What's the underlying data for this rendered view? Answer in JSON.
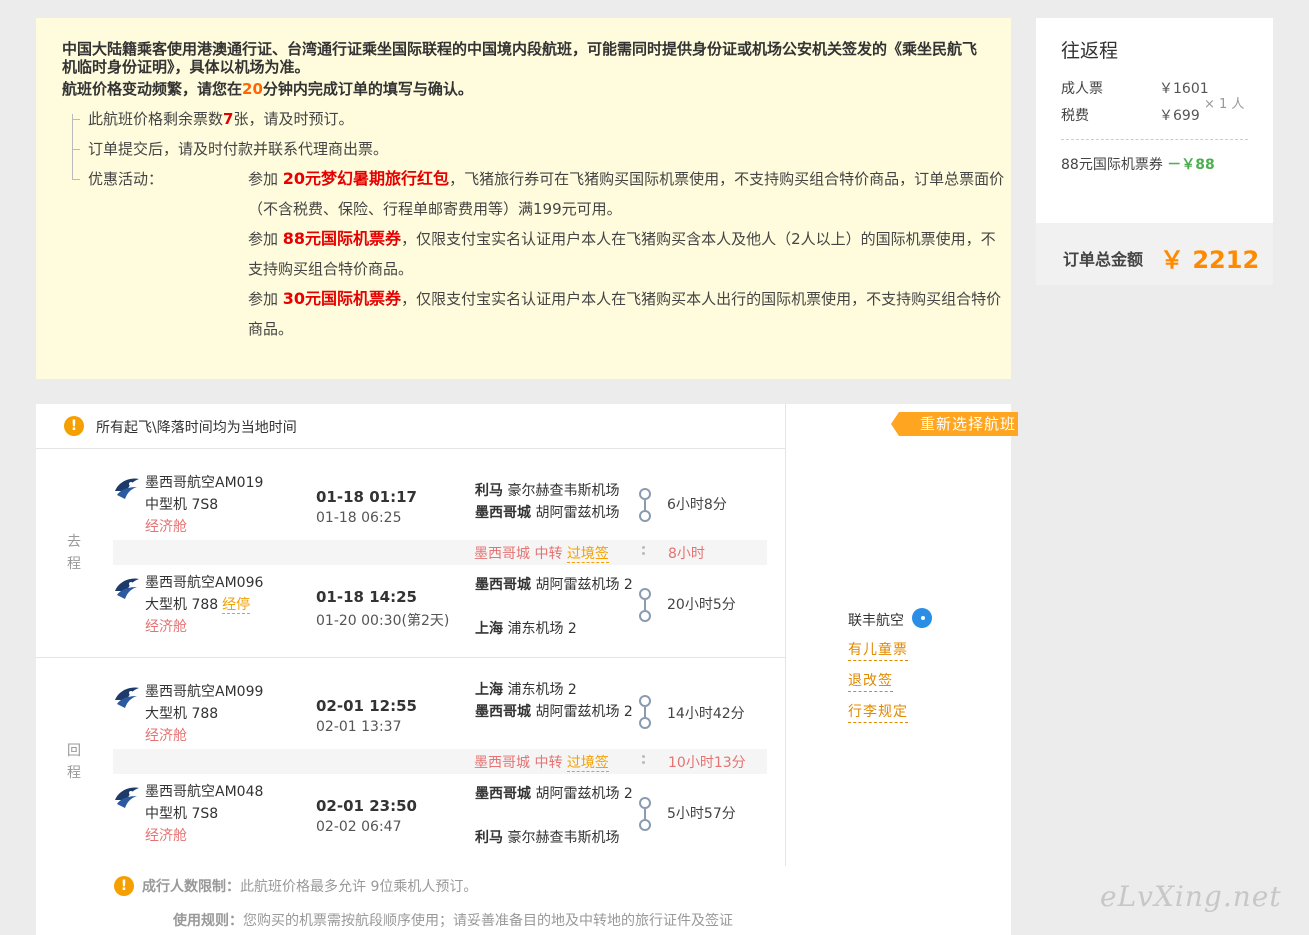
{
  "notice": {
    "line1": "中国大陆籍乘客使用港澳通行证、台湾通行证乘坐国际联程的中国境内段航班，可能需同时提供身份证或机场公安机关签发的《乘坐民航飞机临时身份证明》，具体以机场为准。",
    "line2_pre": "航班价格变动频繁，请您在",
    "line2_num": "20",
    "line2_post": "分钟内完成订单的填写与确认。",
    "seats_pre": "此航班价格剩余票数",
    "seats_num": "7",
    "seats_post": "张，请及时预订。",
    "pay": "订单提交后，请及时付款并联系代理商出票。",
    "promo_label": "优惠活动：",
    "promos": [
      {
        "pre": "参加 ",
        "name": "20元梦幻暑期旅行红包",
        "desc": "，飞猪旅行券可在飞猪购买国际机票使用，不支持购买组合特价商品，订单总票面价（不含税费、保险、行程单邮寄费用等）满199元可用。"
      },
      {
        "pre": "参加 ",
        "name": "88元国际机票券",
        "desc": "，仅限支付宝实名认证用户本人在飞猪购买含本人及他人（2人以上）的国际机票使用，不支持购买组合特价商品。"
      },
      {
        "pre": "参加 ",
        "name": "30元国际机票券",
        "desc": "，仅限支付宝实名认证用户本人在飞猪购买本人出行的国际机票使用，不支持购买组合特价商品。"
      }
    ]
  },
  "summary": {
    "title": "往返程",
    "adult_label": "成人票",
    "adult_price": "￥1601",
    "tax_label": "税费",
    "tax_price": "￥699",
    "multiplier": "× 1 人",
    "coupon_label": "88元国际机票券",
    "coupon_value": "－￥88",
    "total_label": "订单总金额",
    "total_value": "￥ 2212"
  },
  "flights": {
    "header_note": "所有起飞\\降落时间均为当地时间",
    "reselect": "重新选择航班",
    "outbound_label": "去程",
    "return_label": "回程",
    "segments": [
      {
        "airline": "墨西哥航空AM019",
        "plane": "中型机 7S8",
        "stop": "",
        "cabin": "经济舱",
        "dep": "01-18 01:17",
        "arr": "01-18 06:25",
        "from_city": "利马",
        "from_apt": " 豪尔赫查韦斯机场",
        "to_city": "墨西哥城",
        "to_apt": " 胡阿雷兹机场",
        "duration": "6小时8分"
      },
      {
        "airline": "墨西哥航空AM096",
        "plane": "大型机 788",
        "stop": "经停",
        "cabin": "经济舱",
        "dep": "01-18 14:25",
        "arr": "01-20 00:30(第2天)",
        "from_city": "墨西哥城",
        "from_apt": " 胡阿雷兹机场 2",
        "to_city": "上海",
        "to_apt": " 浦东机场 2",
        "duration": "20小时5分"
      },
      {
        "airline": "墨西哥航空AM099",
        "plane": "大型机 788",
        "stop": "",
        "cabin": "经济舱",
        "dep": "02-01 12:55",
        "arr": "02-01 13:37",
        "from_city": "上海",
        "from_apt": " 浦东机场 2",
        "to_city": "墨西哥城",
        "to_apt": " 胡阿雷兹机场 2",
        "duration": "14小时42分"
      },
      {
        "airline": "墨西哥航空AM048",
        "plane": "中型机 7S8",
        "stop": "",
        "cabin": "经济舱",
        "dep": "02-01 23:50",
        "arr": "02-02 06:47",
        "from_city": "墨西哥城",
        "from_apt": " 胡阿雷兹机场 2",
        "to_city": "利马",
        "to_apt": " 豪尔赫查韦斯机场",
        "duration": "5小时57分"
      }
    ],
    "transfers": [
      {
        "city": "墨西哥城 中转 ",
        "visa": "过境签",
        "wait": "8小时"
      },
      {
        "city": "墨西哥城 中转 ",
        "visa": "过境签",
        "wait": "10小时13分"
      }
    ],
    "carrier": "联丰航空",
    "links": [
      "有儿童票",
      "退改签",
      "行李规定"
    ]
  },
  "footer": {
    "limit_label": "成行人数限制：",
    "limit_text": "此航班价格最多允许 9位乘机人预订。",
    "rule_label": "使用规则：",
    "rule_text": "您购买的机票需按航段顺序使用；请妥善准备目的地及中转地的旅行证件及签证"
  },
  "watermark": "eLvXing.net",
  "colors": {
    "accent": "#ffa51f",
    "price": "#ff8a00",
    "red": "#e60000",
    "notice_bg": "#fffbdd"
  }
}
